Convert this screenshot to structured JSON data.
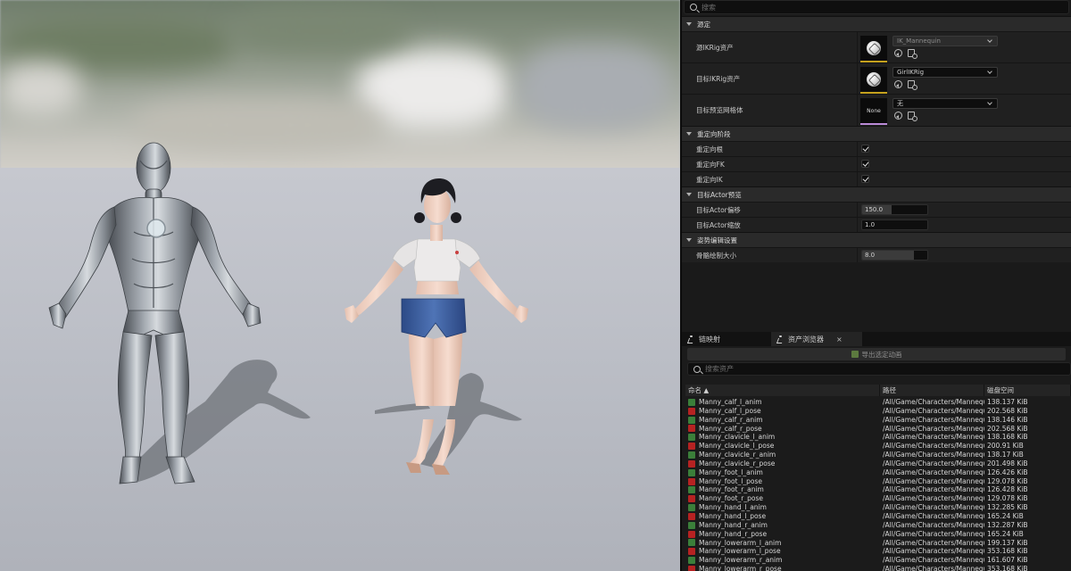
{
  "details": {
    "search_placeholder": "搜索",
    "sections": {
      "source": "源定",
      "retarget_phases": "重定向阶段",
      "target_actor_preview": "目标Actor预览",
      "pose_edit_settings": "姿势编辑设置"
    },
    "source_ikrig": {
      "label": "源IKRig资产",
      "value": "IK_Mannequin"
    },
    "target_ikrig": {
      "label": "目标IKRig资产",
      "value": "GirlIKRig"
    },
    "target_preview_mesh": {
      "label": "目标预览网格体",
      "value": "无",
      "thumb_text": "None"
    },
    "phases": [
      {
        "label": "重定向根",
        "checked": true
      },
      {
        "label": "重定向FK",
        "checked": true
      },
      {
        "label": "重定向IK",
        "checked": true
      }
    ],
    "target_actor_offset": {
      "label": "目标Actor偏移",
      "value": "150.0",
      "fill": 0.45
    },
    "target_actor_scale": {
      "label": "目标Actor缩放",
      "value": "1.0",
      "fill": 0.0
    },
    "bone_draw_size": {
      "label": "骨骼绘制大小",
      "value": "8.0",
      "fill": 0.8
    }
  },
  "tabs": [
    {
      "label": "链映射",
      "active": false
    },
    {
      "label": "资产浏览器",
      "active": true,
      "close": "×"
    }
  ],
  "browser": {
    "export_button": "导出选定动画",
    "search_placeholder": "搜索资产",
    "columns": {
      "name": "命名 ▲",
      "path": "路径",
      "size": "磁盘空间"
    },
    "assets": [
      {
        "name": "Manny_calf_l_anim",
        "type": "anim",
        "path": "/All/Game/Characters/Mannequ",
        "size": "138.137 KiB"
      },
      {
        "name": "Manny_calf_l_pose",
        "type": "pose",
        "path": "/All/Game/Characters/Mannequ",
        "size": "202.568 KiB"
      },
      {
        "name": "Manny_calf_r_anim",
        "type": "anim",
        "path": "/All/Game/Characters/Mannequ",
        "size": "138.146 KiB"
      },
      {
        "name": "Manny_calf_r_pose",
        "type": "pose",
        "path": "/All/Game/Characters/Mannequ",
        "size": "202.568 KiB"
      },
      {
        "name": "Manny_clavicle_l_anim",
        "type": "anim",
        "path": "/All/Game/Characters/Mannequ",
        "size": "138.168 KiB"
      },
      {
        "name": "Manny_clavicle_l_pose",
        "type": "pose",
        "path": "/All/Game/Characters/Mannequ",
        "size": "200.91 KiB"
      },
      {
        "name": "Manny_clavicle_r_anim",
        "type": "anim",
        "path": "/All/Game/Characters/Mannequ",
        "size": "138.17 KiB"
      },
      {
        "name": "Manny_clavicle_r_pose",
        "type": "pose",
        "path": "/All/Game/Characters/Mannequ",
        "size": "201.498 KiB"
      },
      {
        "name": "Manny_foot_l_anim",
        "type": "anim",
        "path": "/All/Game/Characters/Mannequ",
        "size": "126.426 KiB"
      },
      {
        "name": "Manny_foot_l_pose",
        "type": "pose",
        "path": "/All/Game/Characters/Mannequ",
        "size": "129.078 KiB"
      },
      {
        "name": "Manny_foot_r_anim",
        "type": "anim",
        "path": "/All/Game/Characters/Mannequ",
        "size": "126.428 KiB"
      },
      {
        "name": "Manny_foot_r_pose",
        "type": "pose",
        "path": "/All/Game/Characters/Mannequ",
        "size": "129.078 KiB"
      },
      {
        "name": "Manny_hand_l_anim",
        "type": "anim",
        "path": "/All/Game/Characters/Mannequ",
        "size": "132.285 KiB"
      },
      {
        "name": "Manny_hand_l_pose",
        "type": "pose",
        "path": "/All/Game/Characters/Mannequ",
        "size": "165.24 KiB"
      },
      {
        "name": "Manny_hand_r_anim",
        "type": "anim",
        "path": "/All/Game/Characters/Mannequ",
        "size": "132.287 KiB"
      },
      {
        "name": "Manny_hand_r_pose",
        "type": "pose",
        "path": "/All/Game/Characters/Mannequ",
        "size": "165.24 KiB"
      },
      {
        "name": "Manny_lowerarm_l_anim",
        "type": "anim",
        "path": "/All/Game/Characters/Mannequ",
        "size": "199.137 KiB"
      },
      {
        "name": "Manny_lowerarm_l_pose",
        "type": "pose",
        "path": "/All/Game/Characters/Mannequ",
        "size": "353.168 KiB"
      },
      {
        "name": "Manny_lowerarm_r_anim",
        "type": "anim",
        "path": "/All/Game/Characters/Mannequ",
        "size": "161.607 KiB"
      },
      {
        "name": "Manny_lowerarm_r_pose",
        "type": "pose",
        "path": "/All/Game/Characters/Mannequ",
        "size": "353.168 KiB"
      }
    ]
  },
  "colors": {
    "accent_gold": "#c5a11d",
    "accent_purple": "#b98ad6",
    "anim_icon": "#3b7f3a",
    "pose_icon": "#b62222"
  },
  "icons": [
    "search-icon",
    "collapse-arrow-icon",
    "ikrig-asset-icon",
    "chevron-down-icon",
    "reset-arrow-icon",
    "browse-asset-icon",
    "checkmark-icon",
    "running-man-icon",
    "close-icon",
    "export-icon",
    "anim-sequence-icon",
    "pose-asset-icon"
  ]
}
